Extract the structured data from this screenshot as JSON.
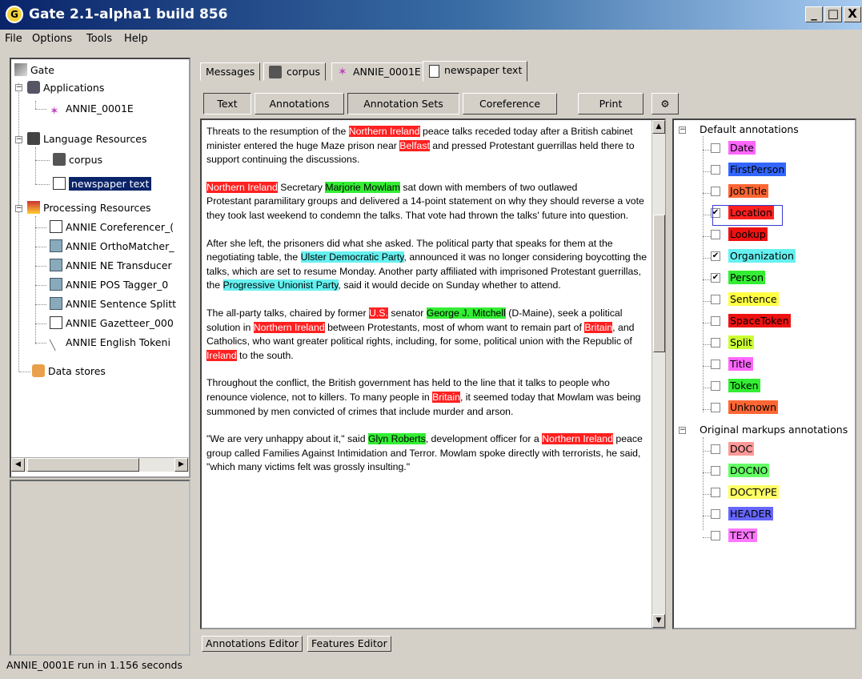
{
  "window": {
    "title": "Gate 2.1-alpha1 build 856",
    "minimize": "_",
    "maximize": "□",
    "close": "X",
    "icon": "gate-logo-icon"
  },
  "menu": [
    "File",
    "Options",
    "Tools",
    "Help"
  ],
  "tree": {
    "root": "Gate",
    "applications": {
      "label": "Applications",
      "items": [
        "ANNIE_0001E"
      ]
    },
    "language_resources": {
      "label": "Language Resources",
      "items": [
        "corpus",
        "newspaper text"
      ],
      "selected": "newspaper text"
    },
    "processing_resources": {
      "label": "Processing Resources",
      "items": [
        "ANNIE Coreferencer_(",
        "ANNIE OrthoMatcher_",
        "ANNIE NE Transducer",
        "ANNIE POS Tagger_0",
        "ANNIE Sentence Splitt",
        "ANNIE Gazetteer_000",
        "ANNIE English Tokeni"
      ]
    },
    "data_stores": "Data stores"
  },
  "doc_tabs": [
    "Messages",
    "corpus",
    "ANNIE_0001E",
    "newspaper text"
  ],
  "toolbar": {
    "text": "Text",
    "annotations": "Annotations",
    "annotation_sets": "Annotation Sets",
    "coreference": "Coreference",
    "print": "Print"
  },
  "document": {
    "p1": [
      "Threats to the resumption of the ",
      "Northern Ireland",
      " peace talks receded today after a British cabinet minister entered the huge Maze prison near ",
      "Belfast",
      " and pressed Protestant guerrillas held there to support continuing the discussions."
    ],
    "p2": [
      "Northern Ireland",
      " Secretary ",
      "Marjorie Mowlam",
      " sat down with members of two outlawed",
      "Protestant paramilitary groups and delivered a 14-point statement on why they should reverse a vote they took last weekend to condemn the talks. That vote had thrown the talks' future into question."
    ],
    "p3": [
      "After she left, the prisoners did what she asked. The political party that speaks for them at the negotiating table, the ",
      "Ulster Democratic Party",
      ", announced it was no longer considering boycotting the talks, which are set to resume Monday. Another party affiliated with imprisoned Protestant guerrillas, the ",
      "Progressive Unionist Party",
      ", said it would decide on Sunday whether to attend."
    ],
    "p4": [
      "The all-party talks, chaired by former ",
      "U.S.",
      " senator ",
      "George J. Mitchell",
      " (D-Maine), seek a political solution in ",
      "Northern Ireland",
      " between Protestants, most of whom want to remain part of ",
      "Britain",
      ", and Catholics, who want greater political rights, including, for some, political union with the Republic of ",
      "Ireland",
      " to the south."
    ],
    "p5": [
      "Throughout the conflict, the British government has held to the line that it talks to people who renounce violence, not to killers. To many people in ",
      "Britain",
      ", it seemed today that Mowlam was being summoned by men convicted of crimes that include murder and arson."
    ],
    "p6": [
      "\"We are very unhappy about it,\" said ",
      "Glyn Roberts",
      ", development officer for a ",
      "Northern Ireland",
      " peace group called Families Against Intimidation and Terror. Mowlam spoke directly with terrorists, he said, \"which many victims felt was grossly insulting.\""
    ]
  },
  "annotations": {
    "default_label": "Default annotations",
    "default": [
      {
        "name": "Date",
        "color": "#ff66ff",
        "checked": false
      },
      {
        "name": "FirstPerson",
        "color": "#3366ff",
        "checked": false
      },
      {
        "name": "JobTitle",
        "color": "#ff6633",
        "checked": false
      },
      {
        "name": "Location",
        "color": "#ff2020",
        "checked": true
      },
      {
        "name": "Lookup",
        "color": "#ee1111",
        "checked": false
      },
      {
        "name": "Organization",
        "color": "#66f0f0",
        "checked": true
      },
      {
        "name": "Person",
        "color": "#33ee33",
        "checked": true
      },
      {
        "name": "Sentence",
        "color": "#ffff44",
        "checked": false
      },
      {
        "name": "SpaceToken",
        "color": "#ee1111",
        "checked": false
      },
      {
        "name": "Split",
        "color": "#ccff33",
        "checked": false
      },
      {
        "name": "Title",
        "color": "#ff66ff",
        "checked": false
      },
      {
        "name": "Token",
        "color": "#33ee33",
        "checked": false
      },
      {
        "name": "Unknown",
        "color": "#ff6633",
        "checked": false
      }
    ],
    "original_label": "Original markups annotations",
    "original": [
      {
        "name": "DOC",
        "color": "#ff9999",
        "checked": false
      },
      {
        "name": "DOCNO",
        "color": "#66ff66",
        "checked": false
      },
      {
        "name": "DOCTYPE",
        "color": "#ffff66",
        "checked": false
      },
      {
        "name": "HEADER",
        "color": "#6666ff",
        "checked": false
      },
      {
        "name": "TEXT",
        "color": "#ff77ff",
        "checked": false
      }
    ]
  },
  "bottom_tabs": [
    "Annotations Editor",
    "Features Editor"
  ],
  "status": "ANNIE_0001E run in 1.156 seconds"
}
